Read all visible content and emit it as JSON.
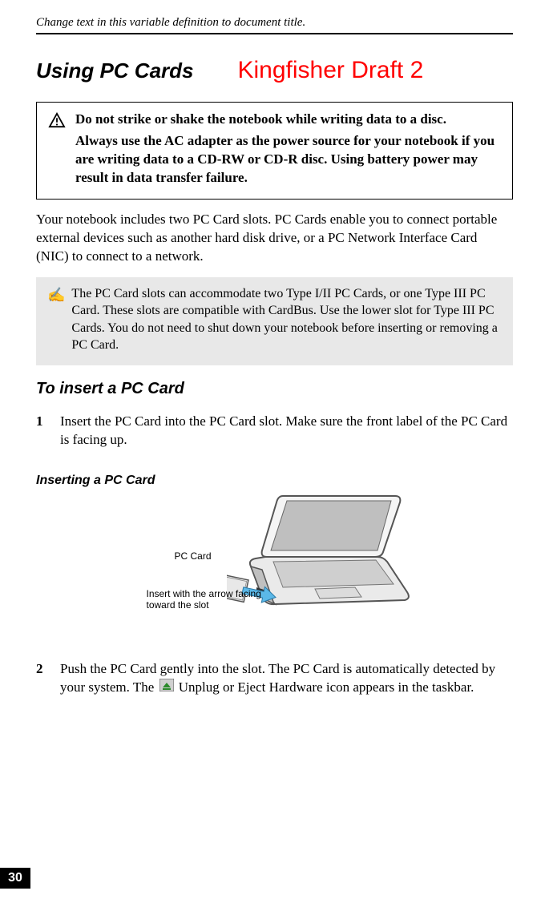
{
  "header": "Change text in this variable definition to document title.",
  "title": "Using PC Cards",
  "draft_stamp": "Kingfisher Draft 2",
  "warning": {
    "line1": "Do not strike or shake the notebook while writing data to a disc.",
    "line2": "Always use the AC adapter as the power source for your notebook if you are writing data to a CD-RW or CD-R disc. Using battery power may result in data transfer failure."
  },
  "intro": "Your notebook includes two PC Card slots. PC Cards enable you to connect portable external devices such as another hard disk drive, or a PC Network Interface Card (NIC) to connect to a network.",
  "note": "The PC Card slots can accommodate two Type I/II PC Cards, or one Type III PC Card. These slots are compatible with CardBus. Use the lower slot for Type III PC Cards. You do not need to shut down your notebook before inserting or removing a PC Card.",
  "subheading": "To insert a PC Card",
  "step1_num": "1",
  "step1": "Insert the PC Card into the PC Card slot. Make sure the front label of the PC Card is facing up.",
  "figure_caption": "Inserting a PC Card",
  "illustration": {
    "pccard_label": "PC Card",
    "insert_label": "Insert with the arrow facing toward the slot"
  },
  "step2_num": "2",
  "step2_a": "Push the PC Card gently into the slot. The PC Card is automatically detected by your system. The ",
  "step2_b": " Unplug or Eject Hardware icon appears in the taskbar.",
  "page_number": "30"
}
